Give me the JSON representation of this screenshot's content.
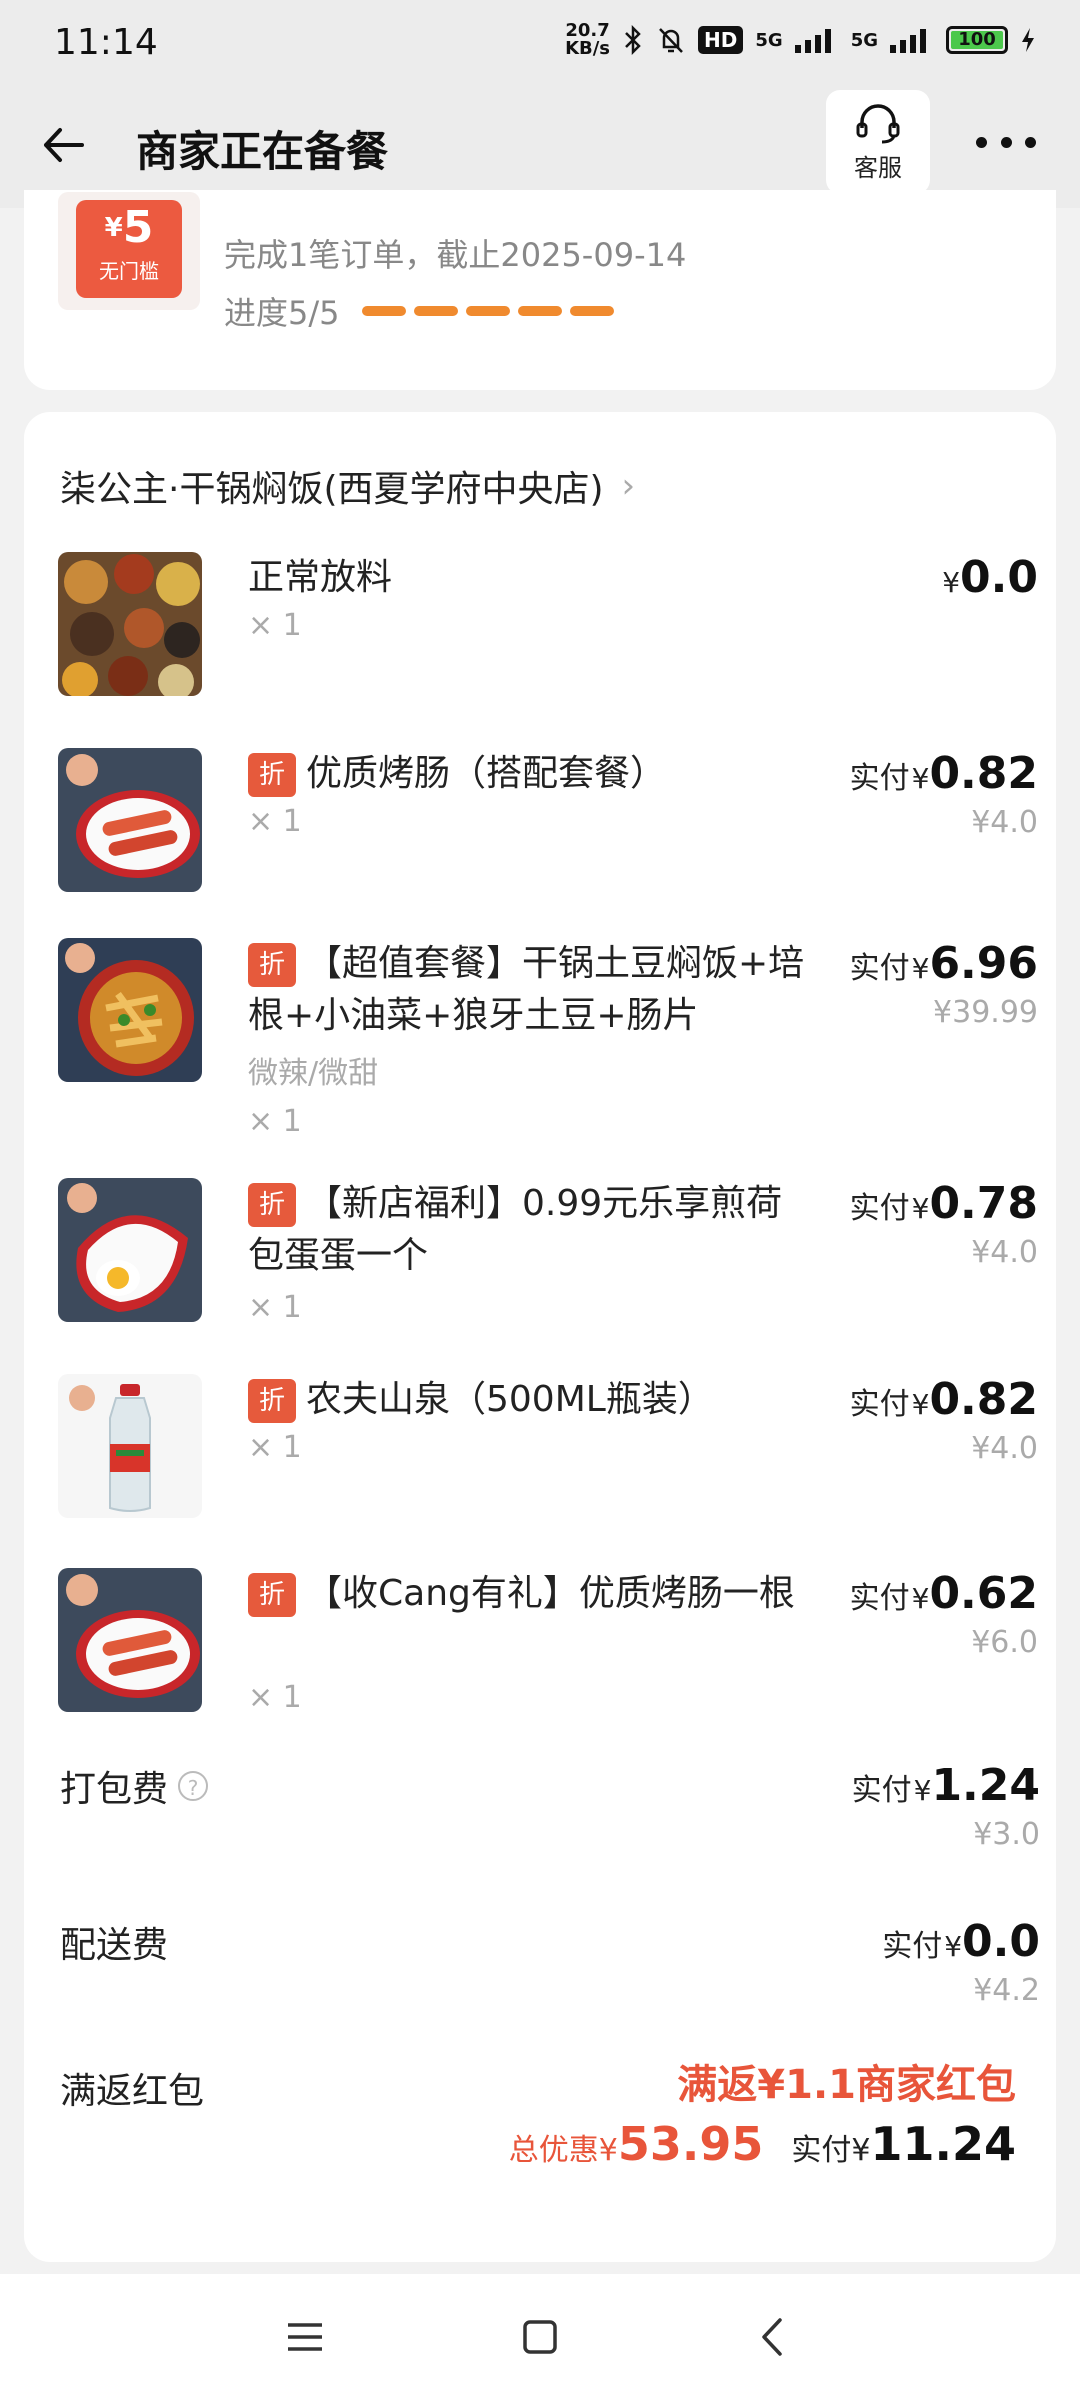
{
  "status_bar": {
    "time": "11:14",
    "net_speed": "20.7",
    "net_unit": "KB/s",
    "hd": "HD",
    "sig1": "5G",
    "sig2": "5G",
    "battery": "100"
  },
  "header": {
    "title": "商家正在备餐",
    "kefu_label": "客服"
  },
  "coupon_card": {
    "amount": "5",
    "currency": "¥",
    "tag": "无门槛",
    "line1": "完成1笔订单，截止2025-09-14",
    "progress_label": "进度5/5",
    "progress_done": 5,
    "progress_total": 5
  },
  "order": {
    "shop_name": "柒公主·干锅焖饭(西夏学府中央店)",
    "paid_label": "实付",
    "currency": "¥",
    "zhe_tag": "折",
    "items": [
      {
        "name": "正常放料",
        "qty": "× 1",
        "paid": "0.0",
        "orig": ""
      },
      {
        "name": "优质烤肠（搭配套餐）",
        "qty": "× 1",
        "paid": "0.82",
        "orig": "¥4.0"
      },
      {
        "name": "【超值套餐】干锅土豆焖饭+培根+小油菜+狼牙土豆+肠片",
        "spec": "微辣/微甜",
        "qty": "× 1",
        "paid": "6.96",
        "orig": "¥39.99"
      },
      {
        "name": "【新店福利】0.99元乐享煎荷包蛋蛋一个",
        "qty": "× 1",
        "paid": "0.78",
        "orig": "¥4.0"
      },
      {
        "name": "农夫山泉（500ML瓶装）",
        "qty": "× 1",
        "paid": "0.82",
        "orig": "¥4.0"
      },
      {
        "name": "【收Cang有礼】优质烤肠一根",
        "qty": "× 1",
        "paid": "0.62",
        "orig": "¥6.0"
      }
    ],
    "packing": {
      "label": "打包费",
      "help": "?",
      "paid": "1.24",
      "orig": "¥3.0"
    },
    "delivery": {
      "label": "配送费",
      "paid": "0.0",
      "orig": "¥4.2"
    },
    "reward": {
      "label": "满返红包",
      "value": "满返¥1.1商家红包"
    },
    "total": {
      "discount_label": "总优惠¥",
      "discount": "53.95",
      "paid_label": "实付¥",
      "paid": "11.24"
    }
  },
  "colors": {
    "accent": "#e8553a",
    "progress": "#f08a2e"
  }
}
